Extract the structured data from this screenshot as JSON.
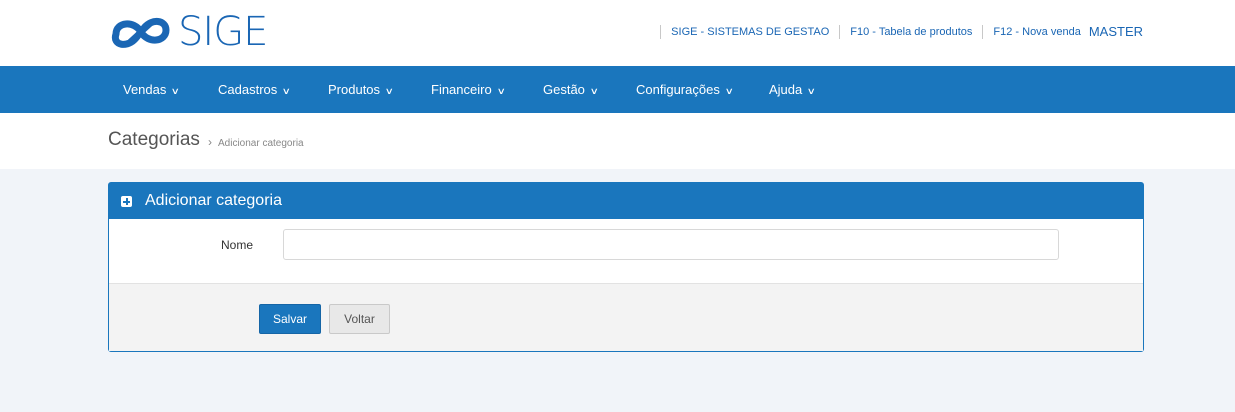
{
  "brand": {
    "logo_text": "SIGE",
    "color": "#1a66b4"
  },
  "header": {
    "links": [
      "SIGE - SISTEMAS DE GESTAO",
      "F10 - Tabela de produtos",
      "F12 - Nova venda"
    ],
    "user": "MASTER"
  },
  "nav": {
    "color": "#1a76bd",
    "items": [
      "Vendas",
      "Cadastros",
      "Produtos",
      "Financeiro",
      "Gestão",
      "Configurações",
      "Ajuda"
    ]
  },
  "breadcrumb": {
    "title": "Categorias",
    "separator": "›",
    "current": "Adicionar categoria"
  },
  "panel": {
    "title": "Adicionar categoria",
    "field_label": "Nome",
    "field_value": "",
    "save_label": "Salvar",
    "back_label": "Voltar"
  },
  "icons": [
    "brand-logo-icon",
    "plus-square-icon",
    "chevron-down-icon"
  ]
}
